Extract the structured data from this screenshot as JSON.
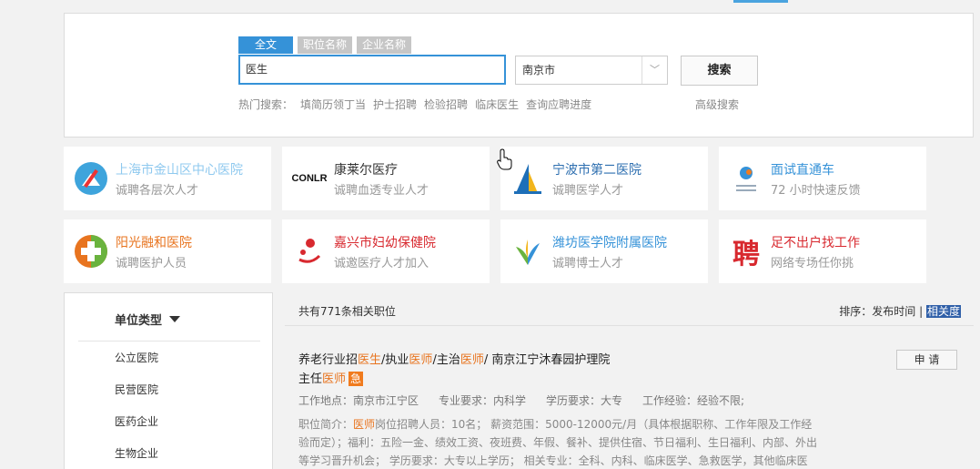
{
  "search": {
    "tabs": [
      "全文",
      "职位名称",
      "企业名称"
    ],
    "keyword": "医生",
    "city": "南京市",
    "search_label": "搜索",
    "hot_label": "热门搜索：",
    "hot_items": [
      "填简历领丁当",
      "护士招聘",
      "检验招聘",
      "临床医生",
      "查询应聘进度"
    ],
    "advanced_label": "高级搜索"
  },
  "ads": [
    {
      "name": "上海市金山区中心医院",
      "sub": "诚聘各层次人才",
      "color": "#8fc9ef",
      "icon": "hospital-cross-icon"
    },
    {
      "name": "康莱尔医疗",
      "sub": "诚聘血透专业人才",
      "color": "#333333",
      "icon": "conlr-logo",
      "logo_text": "CONLR"
    },
    {
      "name": "宁波市第二医院",
      "sub": "诚聘医学人才",
      "color": "#2e6fb0",
      "icon": "building-icon"
    },
    {
      "name": "面试直通车",
      "sub": "72 小时快速反馈",
      "color": "#3592d8",
      "icon": "express-icon"
    },
    {
      "name": "阳光融和医院",
      "sub": "诚聘医护人员",
      "color": "#e8741f",
      "icon": "plus-cross-icon"
    },
    {
      "name": "嘉兴市妇幼保健院",
      "sub": "诚邀医疗人才加入",
      "color": "#d8292f",
      "icon": "mother-child-icon"
    },
    {
      "name": "潍坊医学院附属医院",
      "sub": "诚聘博士人才",
      "color": "#3592d8",
      "icon": "leaf-icon"
    },
    {
      "name": "足不出户找工作",
      "sub": "网络专场任你挑",
      "color": "#d8292f",
      "icon": "recruit-icon",
      "logo_text": "聘"
    }
  ],
  "sidebar": {
    "title": "单位类型",
    "items": [
      "公立医院",
      "民营医院",
      "医药企业",
      "生物企业"
    ]
  },
  "results": {
    "count_text": "共有771条相关职位",
    "sort_label": "排序：",
    "sort_time": "发布时间",
    "sort_sep": " | ",
    "sort_rel": "相关度"
  },
  "job": {
    "title_parts": [
      {
        "t": "养老行业招",
        "hl": false
      },
      {
        "t": "医生",
        "hl": true
      },
      {
        "t": "/执业",
        "hl": false
      },
      {
        "t": "医师",
        "hl": true
      },
      {
        "t": "/主治",
        "hl": false
      },
      {
        "t": "医师",
        "hl": true
      },
      {
        "t": "/ 南京江宁沐春园护理院",
        "hl": false
      }
    ],
    "title_line2_a": "主任",
    "title_line2_hl": "医师",
    "urgent": "急",
    "apply_label": "申 请",
    "meta": [
      "工作地点：南京市江宁区",
      "专业要求：内科学",
      "学历要求：大专",
      "工作经验：经验不限;"
    ],
    "desc_prefix": "职位简介：",
    "desc_hl": "医师",
    "desc_rest": "岗位招聘人员：10名； 薪资范围：5000-12000元/月（具体根据职称、工作年限及工作经验而定）；福利：五险一金、绩效工资、夜班费、年假、餐补、提供住宿、节日福利、生日福利、内部、外出等学习晋升机会； 学历要求：大专以上学历； 相关专业：全科、内科、临床医学、急救医学，其他临床医"
  }
}
